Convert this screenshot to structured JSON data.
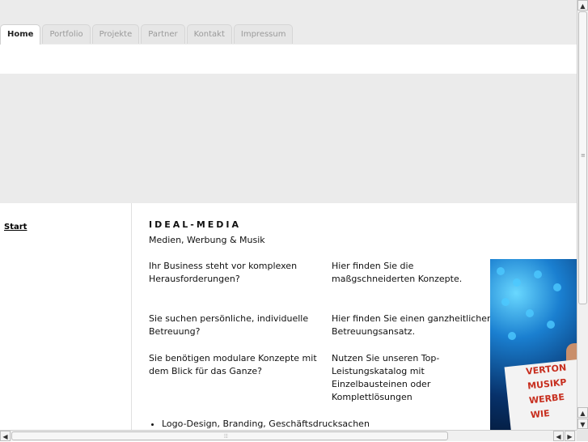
{
  "nav": {
    "tabs": [
      {
        "label": "Home",
        "active": true
      },
      {
        "label": "Portfolio"
      },
      {
        "label": "Projekte"
      },
      {
        "label": "Partner"
      },
      {
        "label": "Kontakt"
      },
      {
        "label": "Impressum"
      }
    ]
  },
  "sidebar": {
    "link": "Start"
  },
  "content": {
    "brand": "IDEAL-MEDIA",
    "subtitle": "Medien, Werbung & Musik",
    "rows": [
      {
        "q": "Ihr Business steht vor komplexen Herausforderungen?",
        "a": "Hier finden Sie die maßgschneiderten Konzepte."
      },
      {
        "q": "Sie suchen persönliche, individuelle Betreuung?",
        "a": "Hier finden Sie einen ganzheitlichen Betreuungsansatz."
      },
      {
        "q": "Sie benötigen modulare Konzepte mit dem Blick für das Ganze?",
        "a": "Nutzen Sie unseren Top-Leistungskatalog mit Einzelbausteinen oder Komplettlösungen"
      }
    ],
    "bullets": [
      "Logo-Design, Branding, Geschäftsdrucksachen"
    ]
  },
  "photo": {
    "sign_lines": [
      "VERTON",
      "MUSIKP",
      "WERBE",
      "WIE"
    ]
  },
  "scroll": {
    "up": "▲",
    "down": "▼",
    "left": "◀",
    "right": "▶"
  },
  "colors": {
    "banner": "#ebebeb",
    "sign_text": "#c72e1e"
  }
}
